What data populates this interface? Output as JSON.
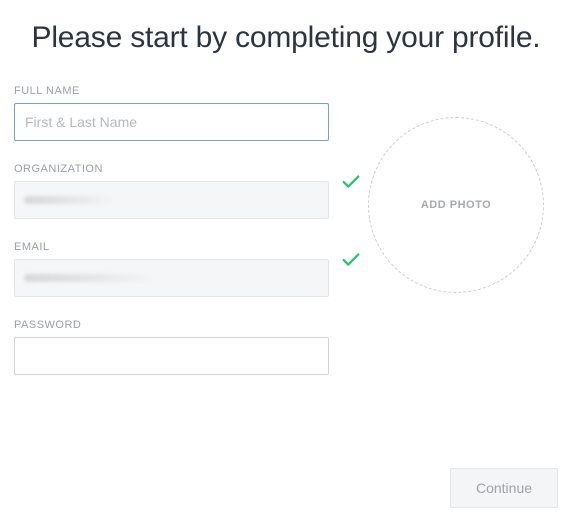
{
  "heading": "Please start by completing your profile.",
  "form": {
    "fullName": {
      "label": "FULL NAME",
      "placeholder": "First & Last Name",
      "value": ""
    },
    "organization": {
      "label": "ORGANIZATION",
      "value": ""
    },
    "email": {
      "label": "EMAIL",
      "value": ""
    },
    "password": {
      "label": "PASSWORD",
      "value": ""
    }
  },
  "photo": {
    "label": "ADD PHOTO"
  },
  "actions": {
    "continue": "Continue"
  }
}
